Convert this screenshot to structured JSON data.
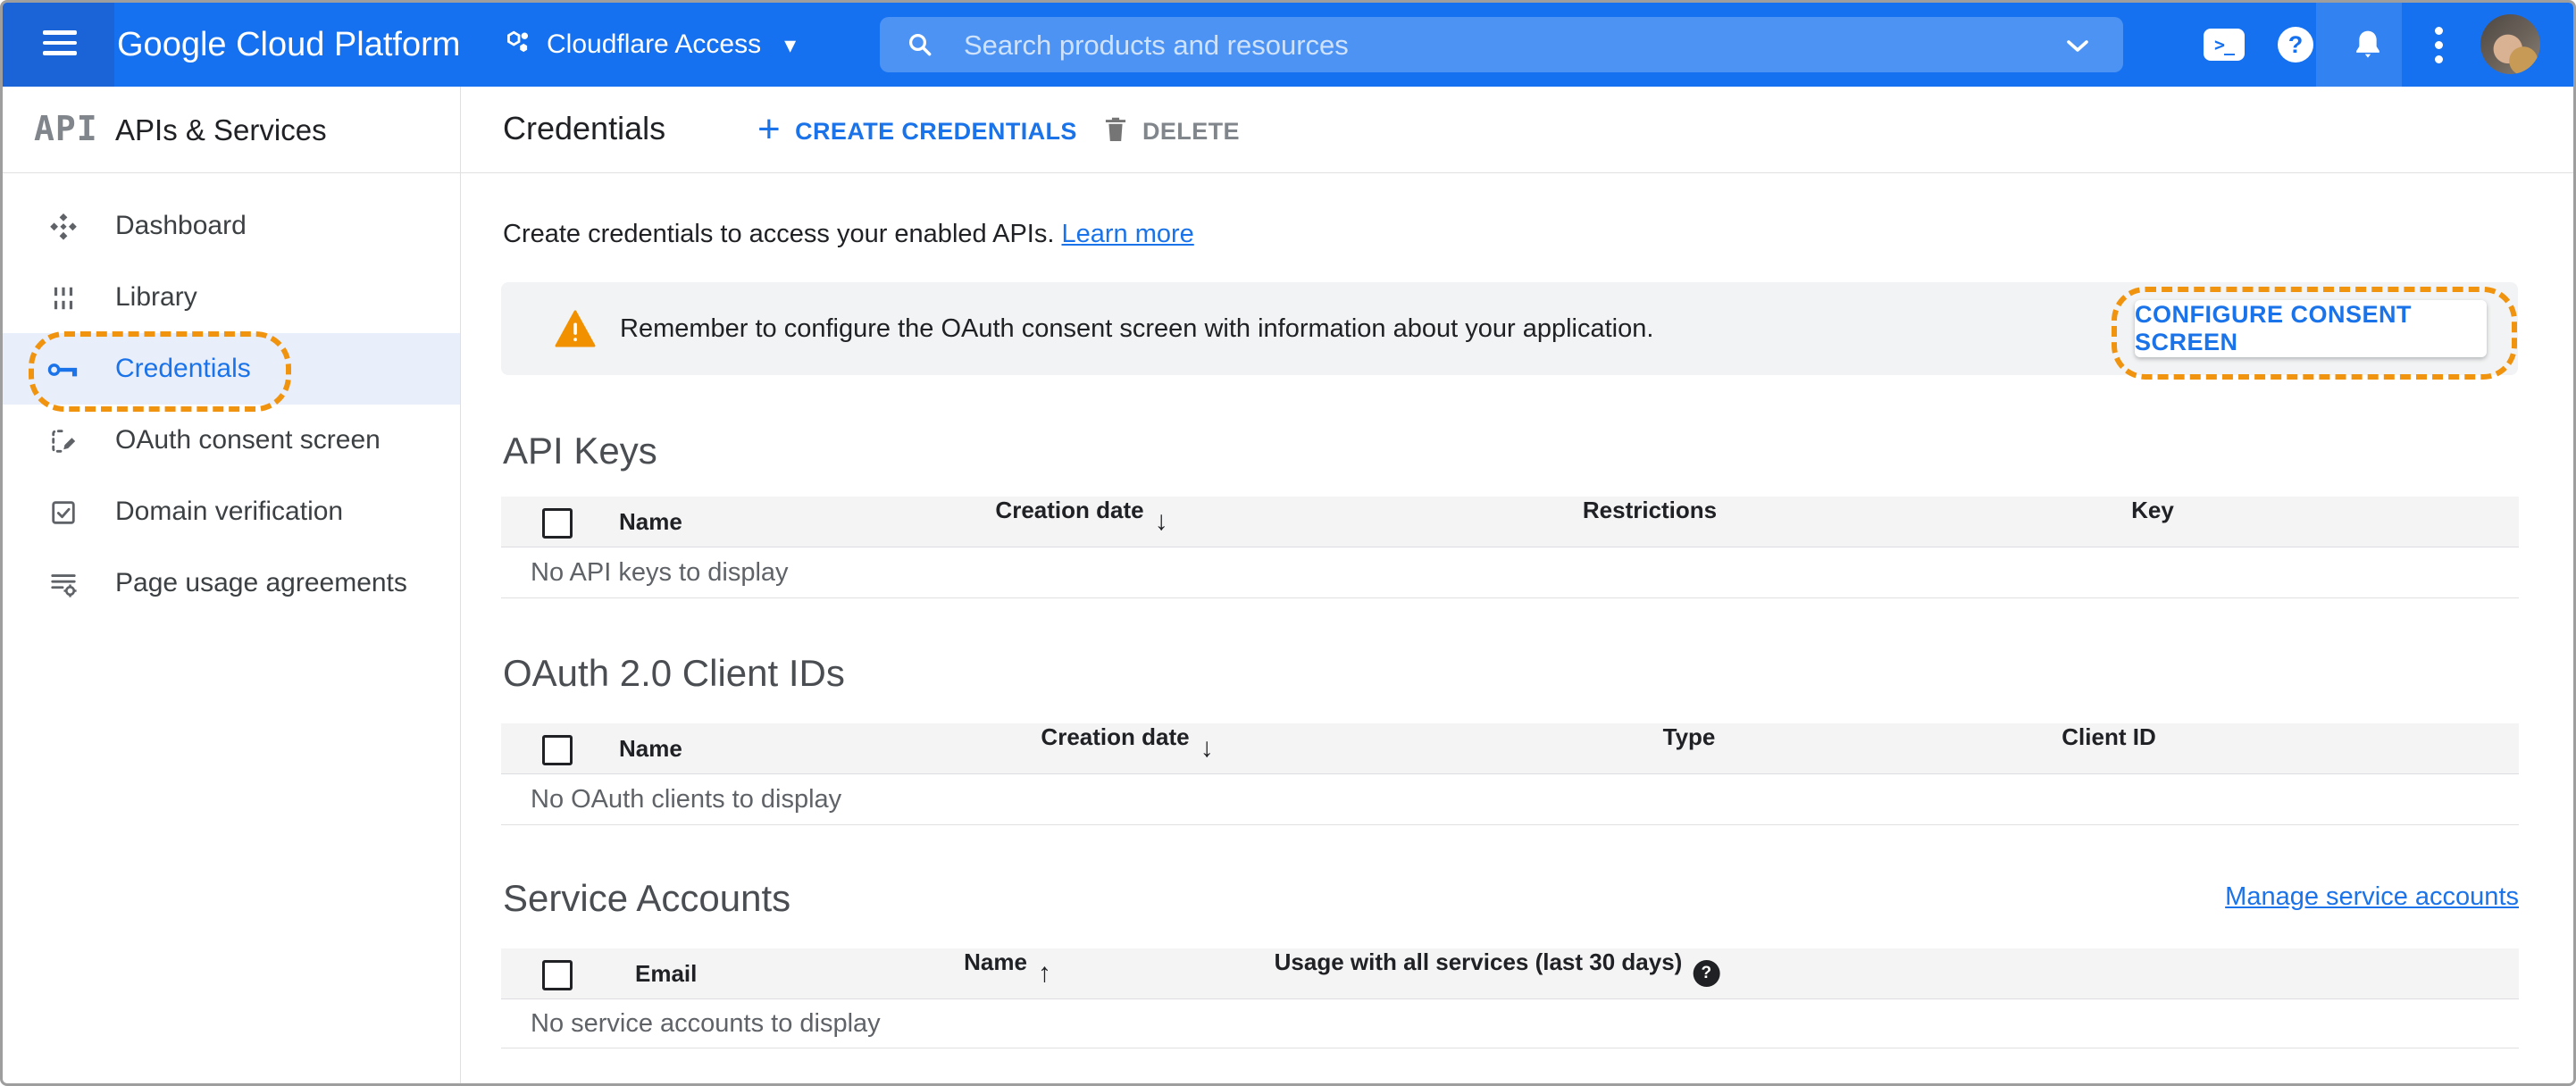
{
  "header": {
    "brand": "Google Cloud Platform",
    "project": "Cloudflare Access",
    "search_placeholder": "Search products and resources"
  },
  "icons": {
    "plus": "+",
    "caret_down": "▾",
    "sort_desc": "↓",
    "sort_asc": "↑",
    "help": "?",
    "shell": ">_"
  },
  "sidebar": {
    "logo": "API",
    "title": "APIs & Services",
    "items": [
      {
        "label": "Dashboard"
      },
      {
        "label": "Library"
      },
      {
        "label": "Credentials"
      },
      {
        "label": "OAuth consent screen"
      },
      {
        "label": "Domain verification"
      },
      {
        "label": "Page usage agreements"
      }
    ]
  },
  "toolbar": {
    "title": "Credentials",
    "create_label": "CREATE CREDENTIALS",
    "delete_label": "DELETE"
  },
  "intro": {
    "text": "Create credentials to access your enabled APIs.",
    "link_label": "Learn more"
  },
  "banner": {
    "message": "Remember to configure the OAuth consent screen with information about your application.",
    "action_label": "CONFIGURE CONSENT SCREEN"
  },
  "api_keys": {
    "title": "API Keys",
    "col_name": "Name",
    "col_creation": "Creation date",
    "col_restrictions": "Restrictions",
    "col_key": "Key",
    "empty": "No API keys to display"
  },
  "oauth_clients": {
    "title": "OAuth 2.0 Client IDs",
    "col_name": "Name",
    "col_creation": "Creation date",
    "col_type": "Type",
    "col_client_id": "Client ID",
    "empty": "No OAuth clients to display"
  },
  "service_accounts": {
    "title": "Service Accounts",
    "manage_link": "Manage service accounts",
    "col_email": "Email",
    "col_name": "Name",
    "col_usage": "Usage with all services (last 30 days)",
    "empty": "No service accounts to display"
  },
  "colors": {
    "header_blue": "#1671f0",
    "accent_blue": "#1a73e8",
    "annotation_orange": "#f0930f",
    "warning_orange": "#f29100",
    "banner_gray": "#f1f3f4",
    "active_row_blue": "#e9eefb"
  }
}
